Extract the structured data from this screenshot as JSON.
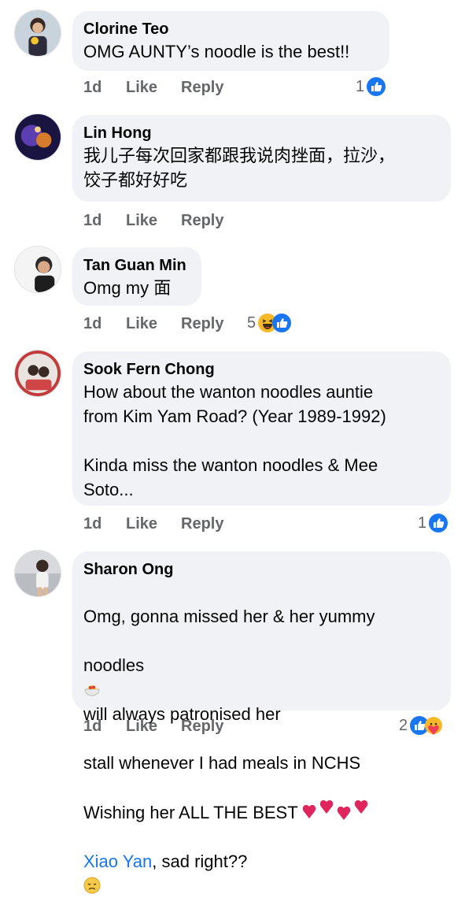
{
  "comments": [
    {
      "name": "Clorine Teo",
      "text": "OMG AUNTY’s noodle is the best!!",
      "time": "1d",
      "like": "Like",
      "reply": "Reply",
      "reaction_count": "1",
      "reactions": [
        "like-icon"
      ]
    },
    {
      "name": "Lin Hong",
      "text": "我儿子每次回家都跟我说肉挫面，拉沙，\n饺子都好好吃",
      "time": "1d",
      "like": "Like",
      "reply": "Reply"
    },
    {
      "name": "Tan Guan Min",
      "text": "Omg my 面",
      "time": "1d",
      "like": "Like",
      "reply": "Reply",
      "reaction_count": "5",
      "reactions": [
        "haha-icon",
        "like-icon"
      ]
    },
    {
      "name": "Sook Fern Chong",
      "text": "How about the wanton noodles auntie\nfrom Kim Yam Road? (Year 1989-1992)\n\nKinda miss the wanton noodles & Mee\nSoto...",
      "time": "1d",
      "like": "Like",
      "reply": "Reply",
      "reaction_count": "1",
      "reactions": [
        "like-icon"
      ]
    },
    {
      "name": "Sharon Ong",
      "text_line1": "Omg, gonna missed her & her yummy",
      "text_line2a": "noodles",
      "text_line2b": "will always patronised her",
      "text_line3": "stall whenever I had meals in NCHS",
      "text_line4": "Wishing her ALL THE BEST",
      "mention": "Xiao Yan",
      "text_line5_rest": ", sad right??",
      "time": "1d",
      "like": "Like",
      "reply": "Reply",
      "reaction_count": "2",
      "reactions": [
        "like-icon",
        "care-icon"
      ]
    }
  ],
  "colors": {
    "bubble": "#f0f2f5",
    "meta": "#65676b",
    "like_blue": "#1876f2",
    "haha_yellow": "#f7b928"
  }
}
